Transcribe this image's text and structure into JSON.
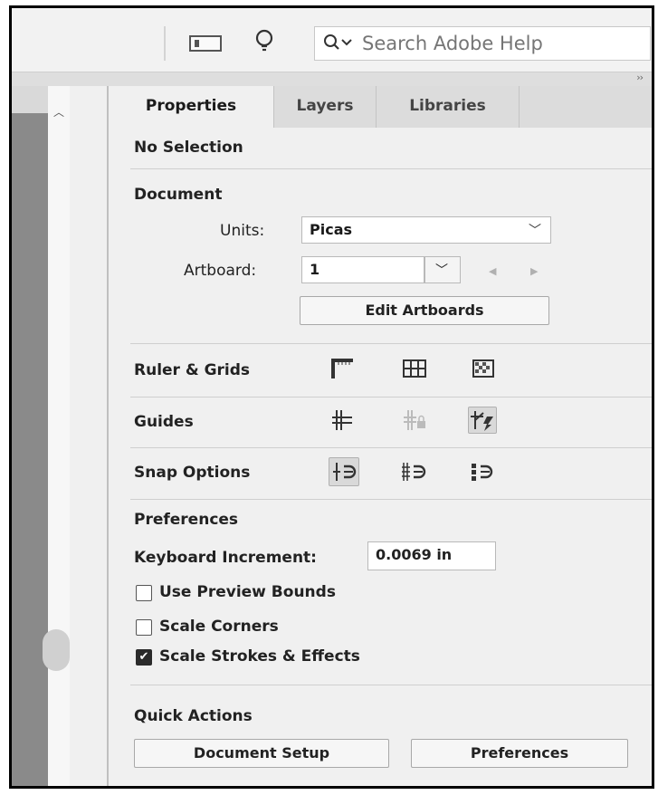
{
  "search": {
    "placeholder": "Search Adobe Help"
  },
  "tabs": [
    {
      "label": "Properties",
      "active": true
    },
    {
      "label": "Layers",
      "active": false
    },
    {
      "label": "Libraries",
      "active": false
    }
  ],
  "selection_status": "No Selection",
  "document": {
    "heading": "Document",
    "units_label": "Units:",
    "units_value": "Picas",
    "artboard_label": "Artboard:",
    "artboard_value": "1",
    "edit_artboards_label": "Edit Artboards"
  },
  "ruler_grids": {
    "label": "Ruler & Grids",
    "icons": [
      "rulers-icon",
      "grid-icon",
      "transparency-grid-icon"
    ]
  },
  "guides": {
    "label": "Guides",
    "icons": [
      "show-guides-icon",
      "lock-guides-icon",
      "smart-guides-icon"
    ]
  },
  "snap_options": {
    "label": "Snap Options",
    "icons": [
      "snap-to-point-icon",
      "snap-to-grid-icon",
      "snap-to-pixel-icon"
    ]
  },
  "preferences": {
    "heading": "Preferences",
    "keyboard_increment_label": "Keyboard Increment:",
    "keyboard_increment_value": "0.0069 in",
    "use_preview_bounds": {
      "label": "Use Preview Bounds",
      "checked": false
    },
    "scale_corners": {
      "label": "Scale Corners",
      "checked": false
    },
    "scale_strokes": {
      "label": "Scale Strokes & Effects",
      "checked": true
    }
  },
  "quick_actions": {
    "heading": "Quick Actions",
    "document_setup_label": "Document Setup",
    "preferences_label": "Preferences"
  },
  "colors": {
    "panel_bg": "#f0f0f0",
    "tab_bg": "#dcdcdc",
    "left_bar": "#8a8a8a"
  }
}
